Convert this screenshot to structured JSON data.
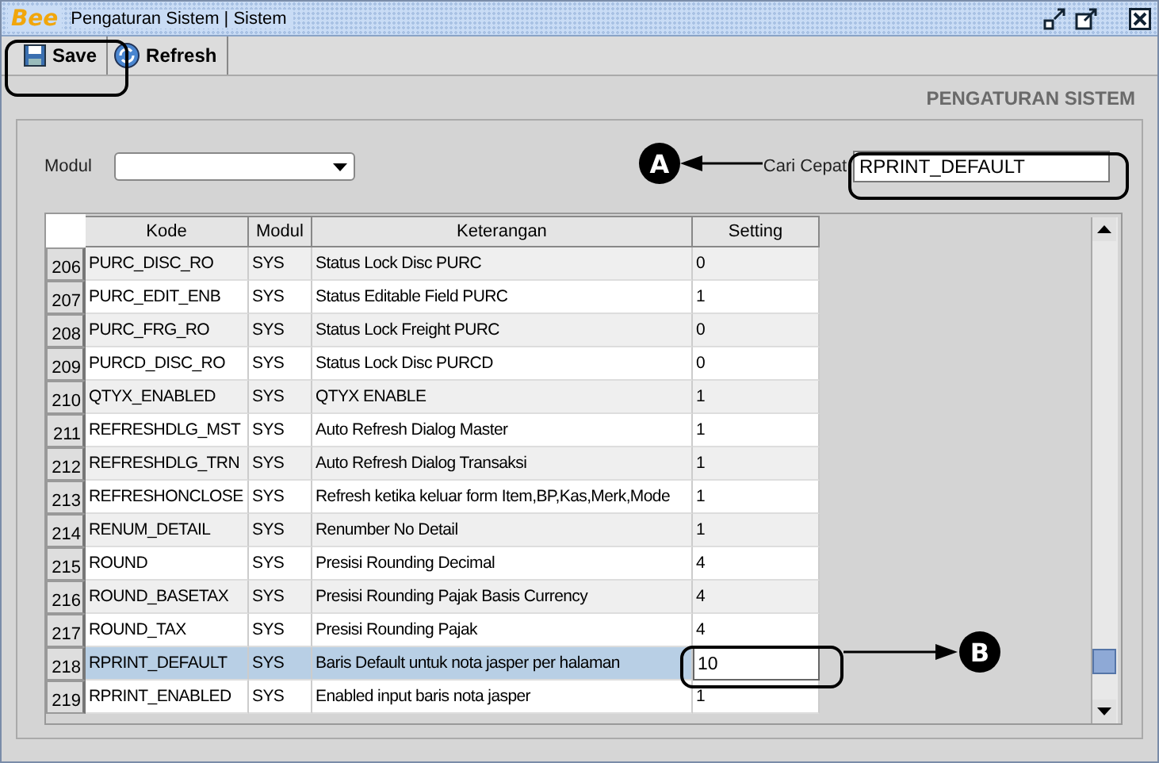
{
  "window": {
    "logo": "Bee",
    "title": "Pengaturan Sistem | Sistem"
  },
  "toolbar": [
    {
      "label": "Save"
    },
    {
      "label": "Refresh"
    }
  ],
  "page_title": "PENGATURAN SISTEM",
  "filter": {
    "modul_label": "Modul",
    "search_label": "Cari Cepat",
    "search_value": "RPRINT_DEFAULT"
  },
  "table": {
    "columns": [
      "Kode",
      "Modul",
      "Keterangan",
      "Setting"
    ],
    "rows": [
      {
        "no": "206",
        "kode": "PURC_DISC_RO",
        "modul": "SYS",
        "keterangan": "Status Lock Disc PURC",
        "setting": "0",
        "selected": false
      },
      {
        "no": "207",
        "kode": "PURC_EDIT_ENB",
        "modul": "SYS",
        "keterangan": "Status Editable Field PURC",
        "setting": "1",
        "selected": false
      },
      {
        "no": "208",
        "kode": "PURC_FRG_RO",
        "modul": "SYS",
        "keterangan": "Status Lock Freight PURC",
        "setting": "0",
        "selected": false
      },
      {
        "no": "209",
        "kode": "PURCD_DISC_RO",
        "modul": "SYS",
        "keterangan": "Status Lock Disc PURCD",
        "setting": "0",
        "selected": false
      },
      {
        "no": "210",
        "kode": "QTYX_ENABLED",
        "modul": "SYS",
        "keterangan": "QTYX ENABLE",
        "setting": "1",
        "selected": false
      },
      {
        "no": "211",
        "kode": "REFRESHDLG_MST",
        "modul": "SYS",
        "keterangan": "Auto Refresh Dialog Master",
        "setting": "1",
        "selected": false
      },
      {
        "no": "212",
        "kode": "REFRESHDLG_TRN",
        "modul": "SYS",
        "keterangan": "Auto Refresh Dialog Transaksi",
        "setting": "1",
        "selected": false
      },
      {
        "no": "213",
        "kode": "REFRESHONCLOSE",
        "modul": "SYS",
        "keterangan": "Refresh ketika keluar form Item,BP,Kas,Merk,Mode",
        "setting": "1",
        "selected": false
      },
      {
        "no": "214",
        "kode": "RENUM_DETAIL",
        "modul": "SYS",
        "keterangan": "Renumber No Detail",
        "setting": "1",
        "selected": false
      },
      {
        "no": "215",
        "kode": "ROUND",
        "modul": "SYS",
        "keterangan": "Presisi Rounding Decimal",
        "setting": "4",
        "selected": false
      },
      {
        "no": "216",
        "kode": "ROUND_BASETAX",
        "modul": "SYS",
        "keterangan": "Presisi Rounding Pajak Basis Currency",
        "setting": "4",
        "selected": false
      },
      {
        "no": "217",
        "kode": "ROUND_TAX",
        "modul": "SYS",
        "keterangan": "Presisi Rounding Pajak",
        "setting": "4",
        "selected": false
      },
      {
        "no": "218",
        "kode": "RPRINT_DEFAULT",
        "modul": "SYS",
        "keterangan": "Baris Default untuk nota jasper per halaman",
        "setting": "10",
        "selected": true
      },
      {
        "no": "219",
        "kode": "RPRINT_ENABLED",
        "modul": "SYS",
        "keterangan": "Enabled input baris nota jasper",
        "setting": "1",
        "selected": false
      }
    ]
  },
  "annotations": [
    {
      "label": "A"
    },
    {
      "label": "B"
    }
  ]
}
